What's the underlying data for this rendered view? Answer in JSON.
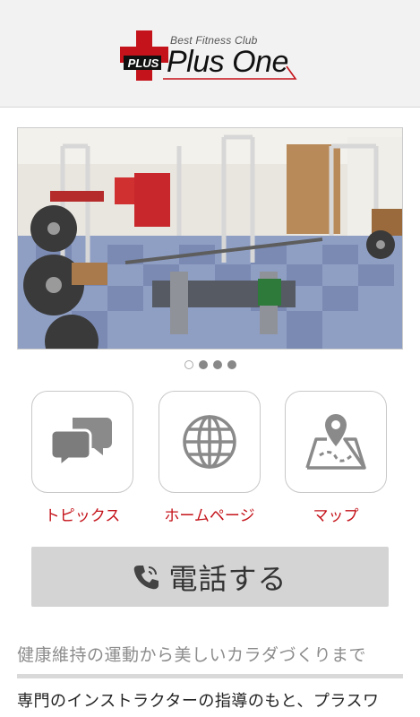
{
  "header": {
    "logo_badge": "PLUS",
    "logo_tagline": "Best Fitness Club",
    "logo_name": "Plus One"
  },
  "slider": {
    "total_slides": 4,
    "active_slide": 1
  },
  "menu": {
    "items": [
      {
        "label": "トピックス",
        "icon": "chat-bubbles-icon"
      },
      {
        "label": "ホームページ",
        "icon": "globe-icon"
      },
      {
        "label": "マップ",
        "icon": "map-pin-icon"
      }
    ]
  },
  "call": {
    "label": "電話する",
    "icon": "phone-icon"
  },
  "content": {
    "heading": "健康維持の運動から美しいカラダづくりまで",
    "body": "専門のインストラクターの指導のもと、プラスワ"
  },
  "colors": {
    "brand_red": "#c4131a",
    "button_gray": "#d4d4d4",
    "header_bg": "#f2f2f2"
  }
}
